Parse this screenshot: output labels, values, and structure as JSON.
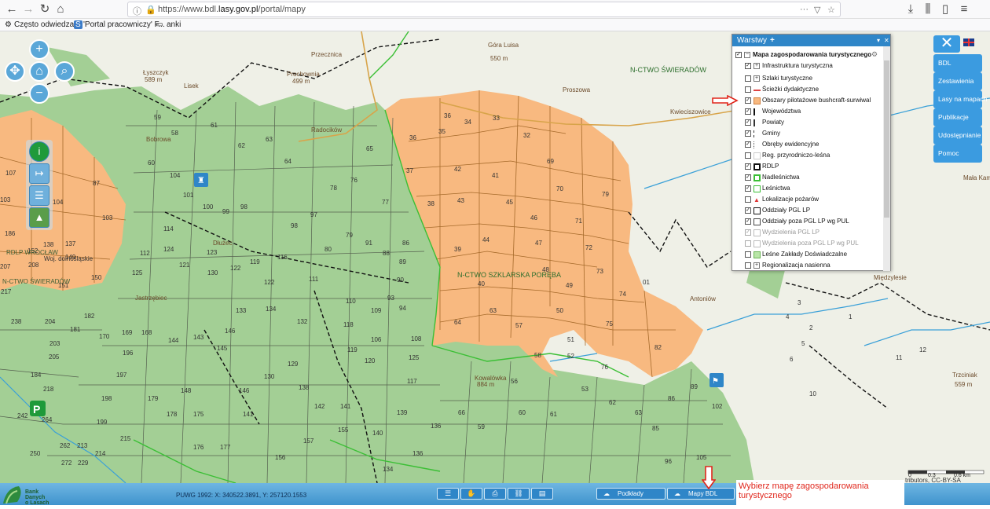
{
  "browser": {
    "url_prefix": "https://www.bdl.",
    "url_domain": "lasy.gov.pl",
    "url_path": "/portal/mapy",
    "bookmarks": [
      "Często odwiedzane",
      "'Portal pracowniczy' F...",
      "anki"
    ]
  },
  "map": {
    "places": [
      {
        "name": "Przecznica",
        "sub": ""
      },
      {
        "name": "Łyszczyk",
        "sub": "589 m"
      },
      {
        "name": "Prochownia",
        "sub": "499 m"
      },
      {
        "name": "Góra Luisa",
        "sub": "550 m"
      },
      {
        "name": "Proszowa",
        "sub": ""
      },
      {
        "name": "Kwieciszowice",
        "sub": ""
      },
      {
        "name": "Antoniów",
        "sub": ""
      },
      {
        "name": "Międzylesie",
        "sub": ""
      },
      {
        "name": "Trzciniak",
        "sub": "559 m"
      },
      {
        "name": "Mała Kam",
        "sub": ""
      },
      {
        "name": "Kowalówka",
        "sub": "884 m"
      },
      {
        "name": "Dłużec",
        "sub": ""
      },
      {
        "name": "Jastrzębiec",
        "sub": ""
      },
      {
        "name": "Bobrowa",
        "sub": ""
      },
      {
        "name": "Radocików",
        "sub": ""
      },
      {
        "name": "Lisek",
        "sub": ""
      }
    ],
    "regions": [
      "N-CTWO ŚWIERADÓW",
      "N-CTWO SZKLARSKA PORĘBA",
      "RDLP WROCŁAW",
      "N-CTWO ŚWIERADÓW",
      "Woj. dolnośląskie"
    ],
    "attribution": "tributors, CC-BY-SA",
    "scale_labels": [
      "0",
      "0.3",
      "0.6 km"
    ]
  },
  "side_menu": {
    "items": [
      "BDL",
      "Zestawienia",
      "Lasy na mapach",
      "Publikacje",
      "Udostępnianie",
      "Pomoc"
    ]
  },
  "layers": {
    "title": "Warstwy",
    "add": "+",
    "items": [
      {
        "label": "Mapa zagospodarowania turystycznego",
        "checked": true
      },
      {
        "label": "Infrastruktura turystyczna",
        "checked": true
      },
      {
        "label": "Szlaki turystyczne",
        "checked": false
      },
      {
        "label": "Ścieżki dydaktyczne",
        "checked": false
      },
      {
        "label": "Obszary pilotażowe bushcraft-surwiwal",
        "checked": true
      },
      {
        "label": "Województwa",
        "checked": true
      },
      {
        "label": "Powiaty",
        "checked": true
      },
      {
        "label": "Gminy",
        "checked": true
      },
      {
        "label": "Obręby ewidencyjne",
        "checked": true
      },
      {
        "label": "Reg. przyrodniczo-leśna",
        "checked": false
      },
      {
        "label": "RDLP",
        "checked": true
      },
      {
        "label": "Nadleśnictwa",
        "checked": true
      },
      {
        "label": "Leśnictwa",
        "checked": true
      },
      {
        "label": "Lokalizacje pożarów",
        "checked": false
      },
      {
        "label": "Oddziały PGL LP",
        "checked": true
      },
      {
        "label": "Oddziały poza PGL LP wg PUL",
        "checked": true
      },
      {
        "label": "Wydzielenia PGL LP",
        "checked": true
      },
      {
        "label": "Wydzielenia poza PGL LP wg PUL",
        "checked": false
      },
      {
        "label": "Leśne Zakłady Doświadczalne",
        "checked": false
      },
      {
        "label": "Regionalizacja nasienna",
        "checked": false
      }
    ]
  },
  "bottom": {
    "coords": "PUWG 1992: X: 340522.3891, Y: 257120.1553",
    "logo": [
      "Bank Danych",
      "o Lasach"
    ],
    "podklady": "Podkłady",
    "mapy_bdl": "Mapy BDL",
    "instruction": "Wybierz mapę zagospodarowania turystycznego"
  }
}
